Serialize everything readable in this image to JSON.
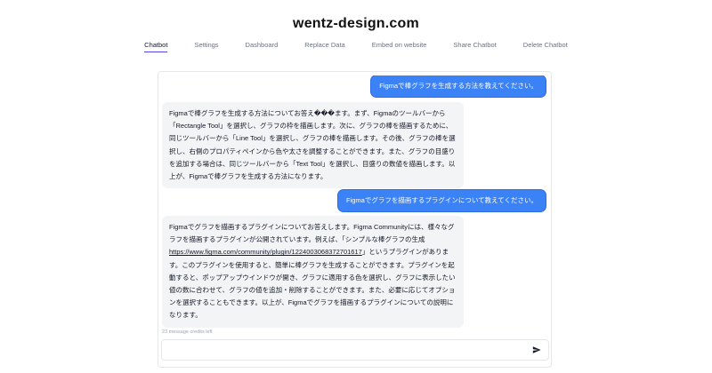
{
  "site": {
    "title": "wentz-design.com"
  },
  "tabs": [
    {
      "label": "Chatbot",
      "active": true
    },
    {
      "label": "Settings",
      "active": false
    },
    {
      "label": "Dashboard",
      "active": false
    },
    {
      "label": "Replace Data",
      "active": false
    },
    {
      "label": "Embed on website",
      "active": false
    },
    {
      "label": "Share Chatbot",
      "active": false
    },
    {
      "label": "Delete Chatbot",
      "active": false
    }
  ],
  "messages": [
    {
      "role": "user",
      "text": "Figmaで棒グラフを生成する方法を教えてください。"
    },
    {
      "role": "bot",
      "text": "Figmaで棒グラフを生成する方法についてお答え���ます。まず、Figmaのツールバーから「Rectangle Tool」を選択し、グラフの枠を描画します。次に、グラフの棒を描画するために、同じツールバーから「Line Tool」を選択し、グラフの棒を描画します。その後、グラフの棒を選択し、右側のプロパティペインから色や太さを調整することができます。また、グラフの目盛りを追加する場合は、同じツールバーから「Text Tool」を選択し、目盛りの数値を描画します。以上が、Figmaで棒グラフを生成する方法になります。"
    },
    {
      "role": "user",
      "text": "Figmaでグラフを描画するプラグインについて教えてください。"
    },
    {
      "role": "bot",
      "text_intro": "Figmaでグラフを描画するプラグインについてお答えします。Figma Communityには、様々なグラフを描画するプラグインが公開されています。例えば、「シンプルな棒グラフの生成",
      "link": "https://www.figma.com/community/plugin/1224003068372701617",
      "text_outro": "」というプラグインがあります。このプラグインを使用すると、簡単に棒グラフを生成することができます。プラグインを起動すると、ポップアップウインドウが開き、グラフに適用する色を選択し、グラフに表示したい値の数に合わせて、グラフの値を追加・削除することができます。また、必要に応じてオプションを選択することもできます。以上が、Figmaでグラフを描画するプラグインについての説明になります。"
    }
  ],
  "credits": "23 message credits left",
  "input": {
    "value": "",
    "placeholder": ""
  },
  "icons": {
    "send": "send-icon"
  },
  "colors": {
    "accent": "#3b82f6",
    "tab_underline": "#4f46e5",
    "bot_bubble": "#f3f4f6"
  }
}
